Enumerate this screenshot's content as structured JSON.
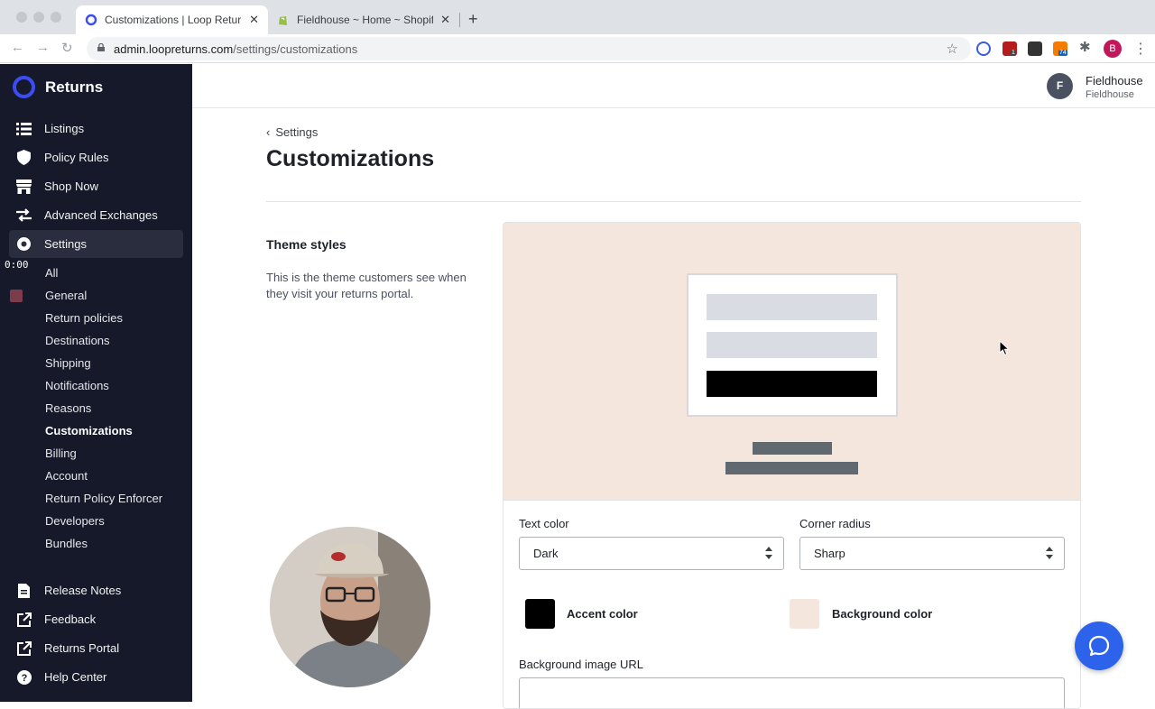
{
  "browser": {
    "tabs": [
      {
        "title": "Customizations | Loop Returns",
        "active": true
      },
      {
        "title": "Fieldhouse ~ Home ~ Shopify",
        "active": false
      }
    ],
    "url_host": "admin.loopreturns.com",
    "url_path": "/settings/customizations",
    "profile_initial": "B",
    "extension_badges": [
      "1",
      "74"
    ]
  },
  "sidebar": {
    "brand": "Returns",
    "items": [
      {
        "label": "Listings",
        "icon": "list-icon"
      },
      {
        "label": "Policy Rules",
        "icon": "shield-icon"
      },
      {
        "label": "Shop Now",
        "icon": "store-icon"
      },
      {
        "label": "Advanced Exchanges",
        "icon": "exchange-arrows-icon"
      },
      {
        "label": "Settings",
        "icon": "gear-icon",
        "active": true
      }
    ],
    "settings_subitems": [
      "All",
      "General",
      "Return policies",
      "Destinations",
      "Shipping",
      "Notifications",
      "Reasons",
      "Customizations",
      "Billing",
      "Account",
      "Return Policy Enforcer",
      "Developers",
      "Bundles"
    ],
    "active_subitem": "Customizations",
    "bottom_items": [
      {
        "label": "Release Notes",
        "icon": "document-icon"
      },
      {
        "label": "Feedback",
        "icon": "external-link-icon"
      },
      {
        "label": "Returns Portal",
        "icon": "external-link-icon"
      },
      {
        "label": "Help Center",
        "icon": "help-circle-icon"
      }
    ],
    "recording_timer": "0:00"
  },
  "header": {
    "avatar_initial": "F",
    "account_name": "Fieldhouse",
    "account_sub": "Fieldhouse"
  },
  "main": {
    "back_label": "Settings",
    "title": "Customizations",
    "section": {
      "title": "Theme styles",
      "description": "This is the theme customers see when they visit your returns portal."
    },
    "form": {
      "text_color_label": "Text color",
      "text_color_value": "Dark",
      "corner_radius_label": "Corner radius",
      "corner_radius_value": "Sharp",
      "accent_color_label": "Accent color",
      "background_color_label": "Background color",
      "background_image_label": "Background image URL",
      "background_image_value": ""
    }
  },
  "colors": {
    "accent": "#000000",
    "background": "#f5e6dd",
    "sidebar": "#16192a",
    "brand": "#3b4cf5",
    "chat_button": "#2c63ea"
  }
}
